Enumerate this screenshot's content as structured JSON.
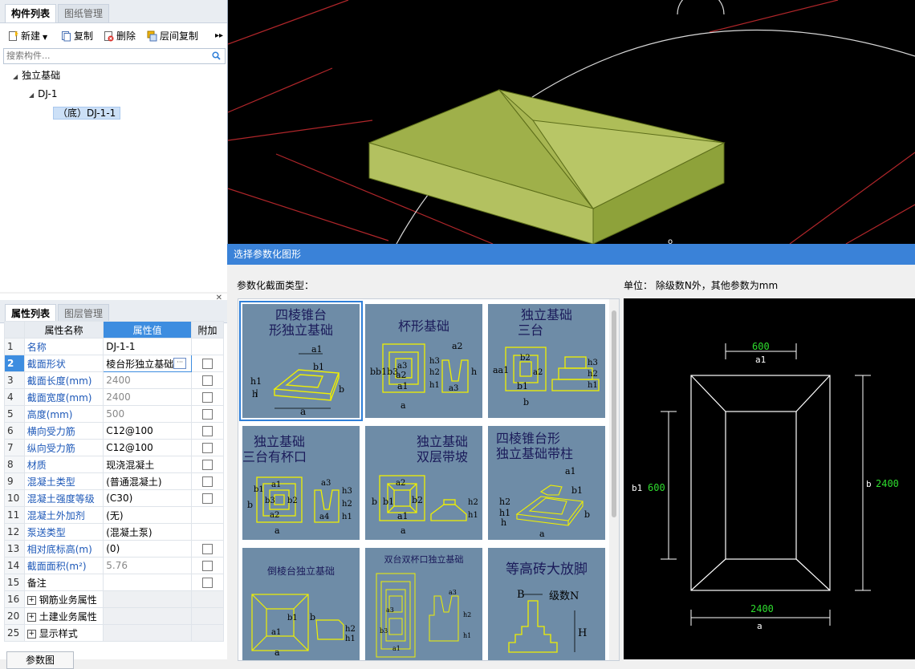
{
  "component_panel": {
    "tabs": [
      "构件列表",
      "图纸管理"
    ],
    "toolbar": {
      "new": "新建",
      "copy": "复制",
      "delete": "删除",
      "floor_copy": "层间复制"
    },
    "search_placeholder": "搜索构件...",
    "tree": {
      "root": "独立基础",
      "child": "DJ-1",
      "leaf": "（底）DJ-1-1"
    }
  },
  "property_panel": {
    "tabs": [
      "属性列表",
      "图层管理"
    ],
    "headers": {
      "name": "属性名称",
      "value": "属性值",
      "extra": "附加"
    },
    "rows": [
      {
        "n": "1",
        "name": "名称",
        "value": "DJ-1-1"
      },
      {
        "n": "2",
        "name": "截面形状",
        "value": "棱台形独立基础"
      },
      {
        "n": "3",
        "name": "截面长度(mm)",
        "value": "2400"
      },
      {
        "n": "4",
        "name": "截面宽度(mm)",
        "value": "2400"
      },
      {
        "n": "5",
        "name": "高度(mm)",
        "value": "500"
      },
      {
        "n": "6",
        "name": "横向受力筋",
        "value": "C12@100"
      },
      {
        "n": "7",
        "name": "纵向受力筋",
        "value": "C12@100"
      },
      {
        "n": "8",
        "name": "材质",
        "value": "现浇混凝土"
      },
      {
        "n": "9",
        "name": "混凝土类型",
        "value": "(普通混凝土)"
      },
      {
        "n": "10",
        "name": "混凝土强度等级",
        "value": "(C30)"
      },
      {
        "n": "11",
        "name": "混凝土外加剂",
        "value": "(无)"
      },
      {
        "n": "12",
        "name": "泵送类型",
        "value": "(混凝土泵)"
      },
      {
        "n": "13",
        "name": "相对底标高(m)",
        "value": "(0)"
      },
      {
        "n": "14",
        "name": "截面面积(m²)",
        "value": "5.76"
      },
      {
        "n": "15",
        "name": "备注",
        "value": ""
      },
      {
        "n": "16",
        "name": "钢筋业务属性",
        "value": ""
      },
      {
        "n": "20",
        "name": "土建业务属性",
        "value": ""
      },
      {
        "n": "25",
        "name": "显示样式",
        "value": ""
      }
    ],
    "bottom_button": "参数图"
  },
  "dialog": {
    "title": "选择参数化图形",
    "section_label": "参数化截面类型：",
    "unit_note": "单位： 除级数N外，其他参数为mm",
    "thumbnails": [
      {
        "title": "四棱锥台形独立基础",
        "l1": "四棱锥台",
        "l2": "形独立基础"
      },
      {
        "title": "杯形基础",
        "l1": "杯形基础",
        "l2": ""
      },
      {
        "title": "独立基础三台",
        "l1": "独立基础",
        "l2": "三台"
      },
      {
        "title": "独立基础三台有杯口",
        "l1": "独立基础",
        "l2": "三台有杯口"
      },
      {
        "title": "独立基础双层带坡",
        "l1": "独立基础",
        "l2": "双层带坡"
      },
      {
        "title": "四棱锥台形独立基础带柱",
        "l1": "四棱锥台形",
        "l2": "独立基础带柱"
      },
      {
        "title": "倒棱台独立基础",
        "l1": "倒棱台独立基础",
        "l2": ""
      },
      {
        "title": "双台双杯口独立基础",
        "l1": "双台双杯口独立基础",
        "l2": ""
      },
      {
        "title": "等高砖大放脚",
        "l1": "等高砖大放脚",
        "l2": ""
      }
    ],
    "preview": {
      "a1_value": "600",
      "a1_label": "a1",
      "b1_value": "600",
      "b1_label": "b1",
      "b_value": "2400",
      "b_label": "b",
      "a_value": "2400",
      "a_label": "a"
    }
  }
}
